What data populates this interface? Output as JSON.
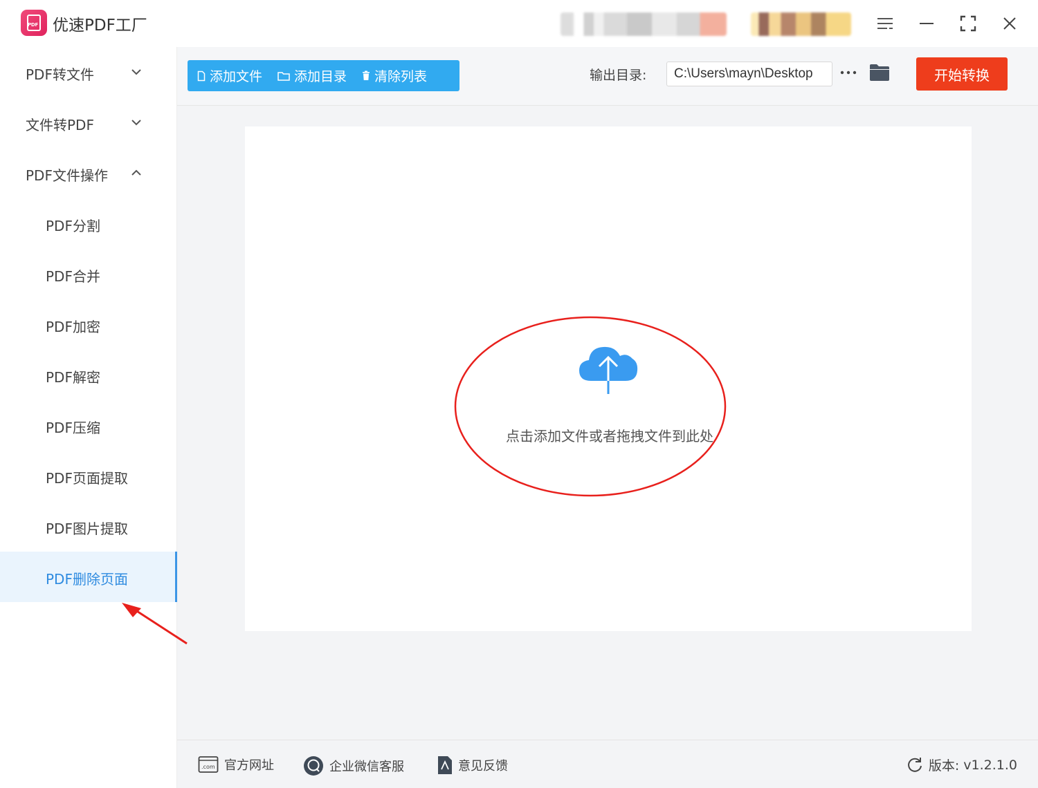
{
  "app": {
    "title": "优速PDF工厂",
    "logo_text": "PDF"
  },
  "window_controls": {
    "menu_icon": "menu-icon",
    "minimize_icon": "minimize-icon",
    "fullscreen_icon": "fullscreen-icon",
    "close_icon": "close-icon"
  },
  "sidebar": {
    "groups": [
      {
        "label": "PDF转文件",
        "expanded": false
      },
      {
        "label": "文件转PDF",
        "expanded": false
      },
      {
        "label": "PDF文件操作",
        "expanded": true
      }
    ],
    "subitems": [
      {
        "label": "PDF分割"
      },
      {
        "label": "PDF合并"
      },
      {
        "label": "PDF加密"
      },
      {
        "label": "PDF解密"
      },
      {
        "label": "PDF压缩"
      },
      {
        "label": "PDF页面提取"
      },
      {
        "label": "PDF图片提取"
      },
      {
        "label": "PDF删除页面",
        "active": true
      }
    ]
  },
  "toolbar": {
    "add_file": "添加文件",
    "add_dir": "添加目录",
    "clear_list": "清除列表",
    "output_label": "输出目录:",
    "output_path": "C:\\Users\\mayn\\Desktop",
    "more_icon": "more-dots-icon",
    "folder_icon": "folder-icon",
    "start": "开始转换"
  },
  "dropzone": {
    "icon": "cloud-upload-icon",
    "text": "点击添加文件或者拖拽文件到此处"
  },
  "footer": {
    "website": "官方网址",
    "wechat": "企业微信客服",
    "feedback": "意见反馈",
    "version_label": "版本:",
    "version_value": "v1.2.1.0"
  },
  "colors": {
    "accent_blue": "#31aaf0",
    "active_blue": "#2f8be0",
    "start_red": "#ee3d1c",
    "annotation_red": "#e8201c"
  }
}
